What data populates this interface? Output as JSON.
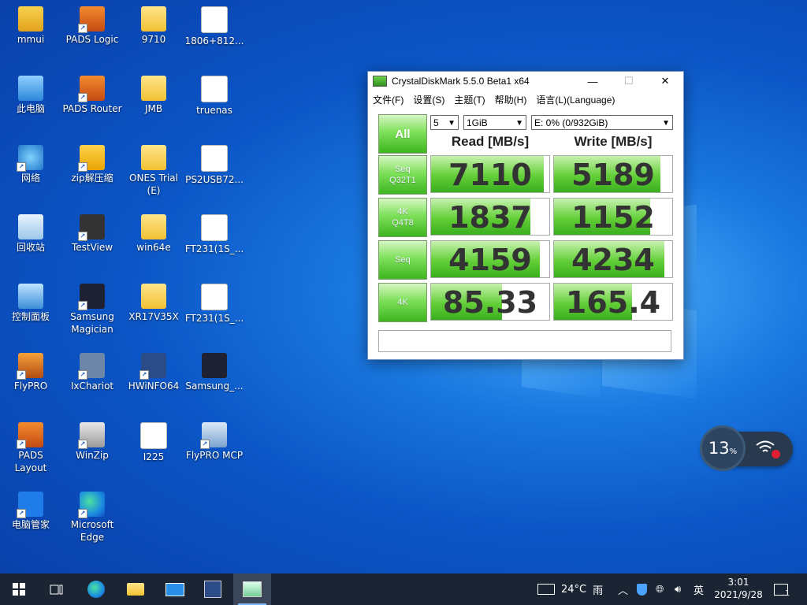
{
  "desktop": {
    "icons": [
      {
        "label": "mmui",
        "icon": "user-folder-icon"
      },
      {
        "label": "PADS Logic",
        "icon": "pads-logic-icon"
      },
      {
        "label": "9710",
        "icon": "folder-icon"
      },
      {
        "label": "1806+812...",
        "icon": "file-icon"
      },
      {
        "label": "此电脑",
        "icon": "computer-icon"
      },
      {
        "label": "PADS Router",
        "icon": "pads-router-icon"
      },
      {
        "label": "JMB",
        "icon": "folder-icon"
      },
      {
        "label": "truenas",
        "icon": "file-icon"
      },
      {
        "label": "网络",
        "icon": "network-icon"
      },
      {
        "label": "zip解压缩",
        "icon": "zip-icon"
      },
      {
        "label": "ONES Trial (E)",
        "icon": "folder-icon"
      },
      {
        "label": "PS2USB72...",
        "icon": "file-icon"
      },
      {
        "label": "回收站",
        "icon": "recycle-bin-icon"
      },
      {
        "label": "TestView",
        "icon": "testview-icon"
      },
      {
        "label": "win64e",
        "icon": "folder-icon"
      },
      {
        "label": "FT231(1S_...",
        "icon": "file-icon"
      },
      {
        "label": "控制面板",
        "icon": "control-panel-icon"
      },
      {
        "label": "Samsung Magician",
        "icon": "samsung-magician-icon"
      },
      {
        "label": "XR17V35X",
        "icon": "folder-icon"
      },
      {
        "label": "FT231(1S_...",
        "icon": "file-icon"
      },
      {
        "label": "FlyPRO",
        "icon": "flypro-icon"
      },
      {
        "label": "IxChariot",
        "icon": "ixchariot-icon"
      },
      {
        "label": "HWiNFO64",
        "icon": "hwinfo-icon"
      },
      {
        "label": "Samsung_...",
        "icon": "samsung-icon"
      },
      {
        "label": "PADS Layout",
        "icon": "pads-layout-icon"
      },
      {
        "label": "WinZip",
        "icon": "winzip-icon"
      },
      {
        "label": "I225",
        "icon": "file-icon"
      },
      {
        "label": "FlyPRO MCP",
        "icon": "flypro-mcp-icon"
      },
      {
        "label": "电脑管家",
        "icon": "pc-manager-icon"
      },
      {
        "label": "Microsoft Edge",
        "icon": "edge-icon"
      }
    ]
  },
  "cdm": {
    "title": "CrystalDiskMark 5.5.0 Beta1 x64",
    "menu": [
      "文件(F)",
      "设置(S)",
      "主题(T)",
      "帮助(H)",
      "语言(L)(Language)"
    ],
    "all_label": "All",
    "count_value": "5",
    "size_value": "1GiB",
    "drive_value": "E: 0% (0/932GiB)",
    "read_header": "Read [MB/s]",
    "write_header": "Write [MB/s]",
    "rows": [
      {
        "label1": "Seq",
        "label2": "Q32T1",
        "read": "7110",
        "write": "5189",
        "read_fill": 0.95,
        "write_fill": 0.9
      },
      {
        "label1": "4K",
        "label2": "Q4T8",
        "read": "1837",
        "write": "1152",
        "read_fill": 0.84,
        "write_fill": 0.81
      },
      {
        "label1": "Seq",
        "label2": "",
        "read": "4159",
        "write": "4234",
        "read_fill": 0.92,
        "write_fill": 0.93
      },
      {
        "label1": "4K",
        "label2": "",
        "read": "85.33",
        "write": "165.4",
        "read_fill": 0.6,
        "write_fill": 0.66
      }
    ],
    "comment": ""
  },
  "widget": {
    "percent": "13",
    "unit": "%"
  },
  "taskbar": {
    "weather_temp": "24°C",
    "weather_text": "雨",
    "ime": "英",
    "time": "3:01",
    "date": "2021/9/28",
    "notification_count": "1"
  }
}
